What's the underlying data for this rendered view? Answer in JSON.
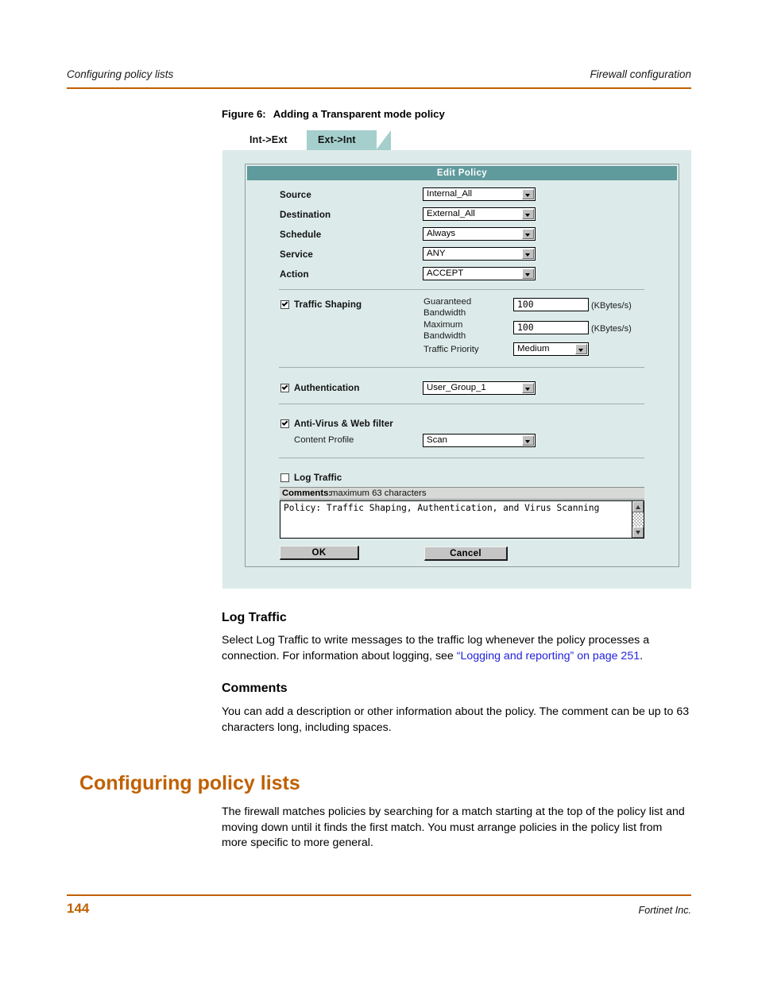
{
  "header": {
    "left": "Configuring policy lists",
    "right": "Firewall configuration",
    "rule_color": "#c06000"
  },
  "figure": {
    "caption_number": "Figure 6:",
    "caption_text": "Adding a Transparent mode policy",
    "tabs": [
      {
        "label": "Int->Ext",
        "active": false
      },
      {
        "label": "Ext->Int",
        "active": true
      }
    ],
    "card_title": "Edit Policy",
    "fields": [
      {
        "label": "Source",
        "value": "Internal_All"
      },
      {
        "label": "Destination",
        "value": "External_All"
      },
      {
        "label": "Schedule",
        "value": "Always"
      },
      {
        "label": "Service",
        "value": "ANY"
      },
      {
        "label": "Action",
        "value": "ACCEPT"
      }
    ],
    "traffic_shaping": {
      "label": "Traffic Shaping",
      "checked": true,
      "guaranteed_label_line1": "Guaranteed",
      "guaranteed_label_line2": "Bandwidth",
      "guaranteed_value": "100",
      "guaranteed_unit": "(KBytes/s)",
      "maximum_label_line1": "Maximum",
      "maximum_label_line2": "Bandwidth",
      "maximum_value": "100",
      "maximum_unit": "(KBytes/s)",
      "priority_label": "Traffic Priority",
      "priority_value": "Medium"
    },
    "authentication": {
      "label": "Authentication",
      "checked": true,
      "group_value": "User_Group_1"
    },
    "antivirus": {
      "label": "Anti-Virus & Web filter",
      "checked": true,
      "profile_label": "Content Profile",
      "profile_value": "Scan"
    },
    "log_traffic": {
      "label": "Log Traffic",
      "checked": false
    },
    "comments": {
      "bar_strong": "Comments:",
      "bar_plain": "maximum 63 characters",
      "text": "Policy: Traffic Shaping, Authentication, and Virus Scanning"
    },
    "buttons": {
      "ok": "OK",
      "cancel": "Cancel"
    },
    "colors": {
      "panel_bg": "#dcebe9",
      "title_bar": "#5f9a9c",
      "tab_active": "#a5cfcd"
    }
  },
  "body": {
    "section_log_traffic": {
      "heading": "Log Traffic",
      "para_before_link": "Select Log Traffic to write messages to the traffic log whenever the policy processes a connection. For information about logging, see ",
      "link_text": "“Logging and reporting” on page 251",
      "para_after_link": "."
    },
    "section_comments": {
      "heading": "Comments",
      "paragraph": "You can add a description or other information about the policy. The comment can be up to 63 characters long, including spaces."
    },
    "section_policy_lists": {
      "heading": "Configuring policy lists",
      "paragraph": "The firewall matches policies by searching for a match starting at the top of the policy list and moving down until it finds the first match. You must arrange policies in the policy list from more specific to more general."
    }
  },
  "footer": {
    "page_number": "144",
    "company": "Fortinet Inc."
  }
}
